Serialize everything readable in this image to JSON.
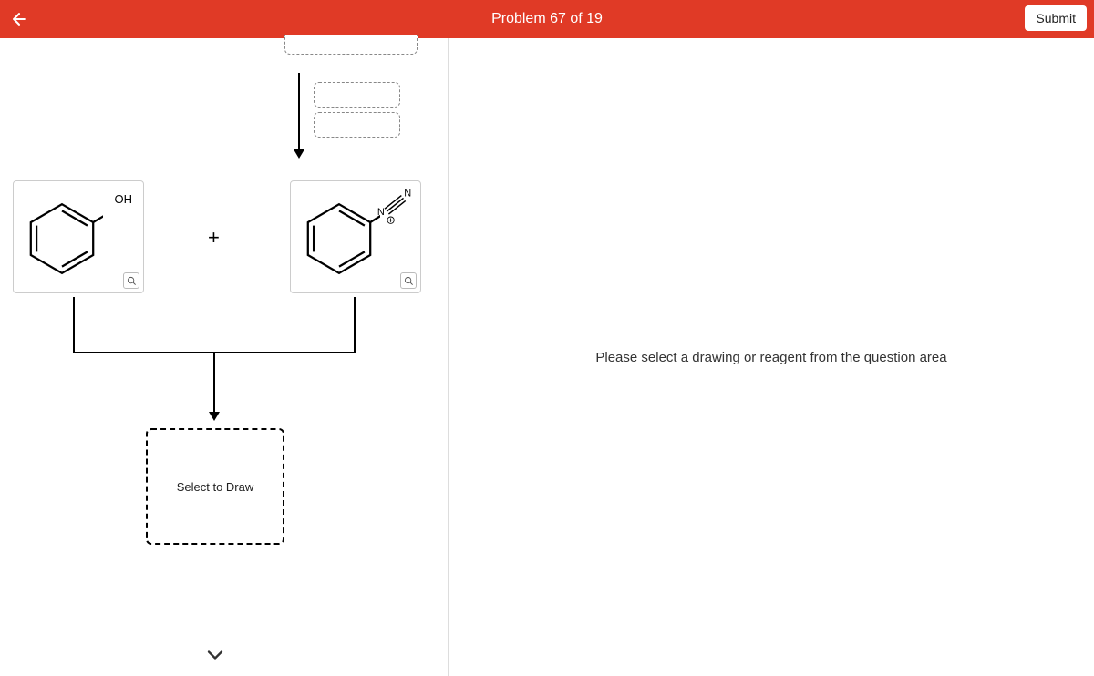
{
  "header": {
    "title": "Problem 67 of 19",
    "submit_label": "Submit"
  },
  "right_panel": {
    "message": "Please select a drawing or reagent from the question area"
  },
  "molecules": {
    "mol1_label": "OH",
    "mol2_atom1": "N",
    "mol2_atom2": "N",
    "mol2_charge": "⊕"
  },
  "symbols": {
    "plus": "+"
  },
  "draw_target": {
    "label": "Select to Draw"
  }
}
